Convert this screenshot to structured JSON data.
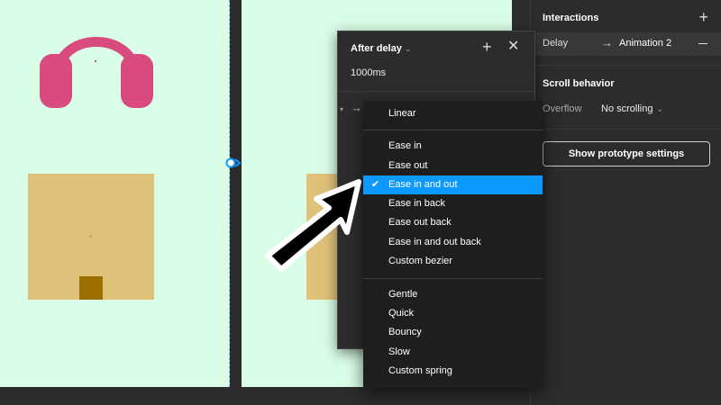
{
  "interactions_panel": {
    "title": "Interactions",
    "add_label": "+",
    "trigger": "Delay",
    "arrow": "→",
    "destination": "Animation 2"
  },
  "scroll_behavior": {
    "title": "Scroll behavior",
    "overflow_label": "Overflow",
    "overflow_value": "No scrolling",
    "chevron": "⌄"
  },
  "prototype_button": "Show prototype settings",
  "popover": {
    "title": "After delay",
    "chevron": "⌄",
    "add_label": "+",
    "close_label": "✕",
    "delay_value": "1000ms",
    "caret": "▾",
    "arrow": "→"
  },
  "easing_menu": {
    "check": "✔",
    "selected": "Ease in and out",
    "items": [
      "Linear",
      "Ease in",
      "Ease out",
      "Ease in and out",
      "Ease in back",
      "Ease out back",
      "Ease in and out back",
      "Custom bezier",
      "Gentle",
      "Quick",
      "Bouncy",
      "Slow",
      "Custom spring"
    ]
  },
  "colors": {
    "canvas_frame": "#d9fde6",
    "headphones": "#d94a7f",
    "box": "#dfc17a",
    "box_inner": "#9c7000",
    "selection": "#0d99ff",
    "panel_bg": "#2c2c2c",
    "menu_bg": "#1e1e1e"
  }
}
